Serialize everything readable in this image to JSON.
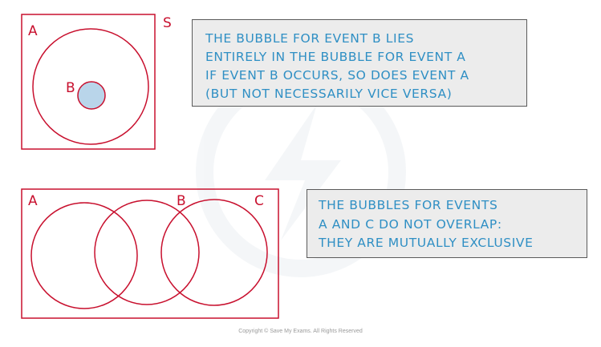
{
  "colors": {
    "outline": "#c8102e",
    "fill_b": "#b9d5ea",
    "note_text": "#2f8fc4",
    "note_bg": "#ececec"
  },
  "diagram_subset": {
    "label_sample_space": "S",
    "label_a": "A",
    "label_b": "B"
  },
  "diagram_exclusive": {
    "label_a": "A",
    "label_b": "B",
    "label_c": "C"
  },
  "note_subset": {
    "lines": [
      "THE BUBBLE FOR EVENT B LIES",
      "ENTIRELY IN THE BUBBLE FOR EVENT A",
      "IF EVENT B OCCURS, SO DOES EVENT A",
      "(BUT NOT NECESSARILY VICE VERSA)"
    ]
  },
  "note_exclusive": {
    "lines": [
      "THE BUBBLES FOR EVENTS",
      "A AND C DO NOT OVERLAP:",
      "THEY ARE MUTUALLY EXCLUSIVE"
    ]
  },
  "copyright": "Copyright © Save My Exams. All Rights Reserved"
}
